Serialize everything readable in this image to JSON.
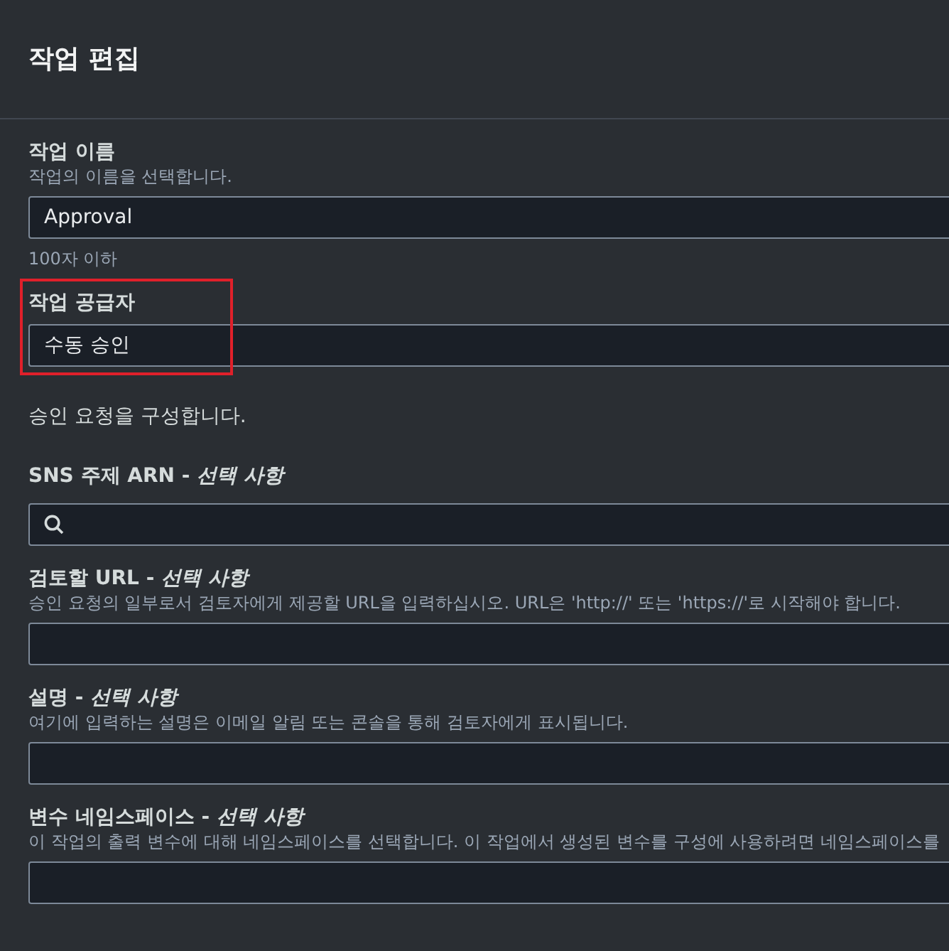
{
  "dialog": {
    "title": "작업 편집"
  },
  "sections": [
    {
      "kind": "text",
      "label": "작업 이름",
      "description": "작업의 이름을 선택합니다.",
      "value": "Approval",
      "hint": "100자 이하",
      "highlighted": false
    },
    {
      "kind": "select",
      "label": "작업 공급자",
      "value": "수동 승인",
      "highlighted": true
    },
    {
      "kind": "note",
      "text": "승인 요청을 구성합니다."
    },
    {
      "kind": "search",
      "label": "SNS 주제 ARN - *선택 사항*",
      "highlighted": false
    },
    {
      "kind": "text",
      "label": "검토할 URL - *선택 사항*",
      "description": "승인 요청의 일부로서 검토자에게 제공할 URL을 입력하십시오. URL은 'http://' 또는 'https://'로 시작해야 합니다.",
      "highlighted": false
    },
    {
      "kind": "text",
      "label": "설명 - *선택 사항*",
      "description": "여기에 입력하는 설명은 이메일 알림 또는 콘솔을 통해 검토자에게 표시됩니다.",
      "highlighted": false
    },
    {
      "kind": "text",
      "label": "변수 네임스페이스 - *선택 사항*",
      "description": "이 작업의 출력 변수에 대해 네임스페이스를 선택합니다. 이 작업에서 생성된 변수를 구성에 사용하려면 네임스페이스를",
      "highlighted": false
    }
  ]
}
